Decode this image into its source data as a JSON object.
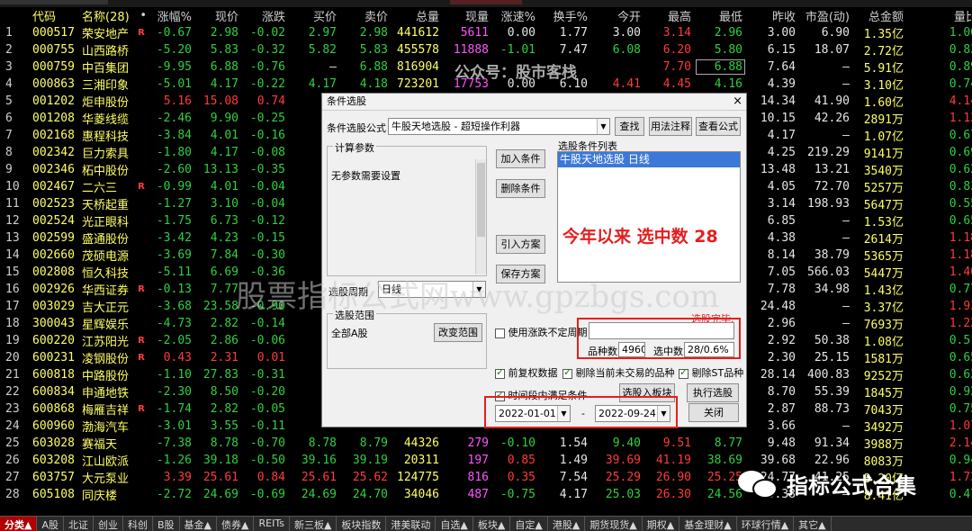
{
  "columns": [
    "",
    "代码",
    "名称(28)",
    "•",
    "涨幅%",
    "现价",
    "涨跌",
    "买价",
    "卖价",
    "总量",
    "现量",
    "涨速%",
    "换手%",
    "今开",
    "最高",
    "最低",
    "昨收",
    "市盈(动)",
    "总金额",
    "量比"
  ],
  "rows": [
    [
      "1",
      "000517",
      "荣安地产",
      "R",
      "-0.67",
      "2.98",
      "-0.02",
      "2.97",
      "2.98",
      "441612",
      "5611",
      "0.00",
      "1.77",
      "3.00",
      "3.14",
      "2.96",
      "3.00",
      "6.90",
      "1.35亿",
      "1.00"
    ],
    [
      "2",
      "000755",
      "山西路桥",
      "",
      "-5.20",
      "5.83",
      "-0.32",
      "5.82",
      "5.83",
      "455578",
      "11888",
      "-1.01",
      "7.47",
      "6.08",
      "6.20",
      "5.80",
      "6.15",
      "18.07",
      "2.72亿",
      "0.83"
    ],
    [
      "3",
      "000759",
      "中百集团",
      "",
      "-9.95",
      "6.88",
      "-0.76",
      "—",
      "6.88",
      "816904",
      "",
      "",
      "",
      "",
      "7.70",
      "6.88",
      "7.64",
      "—",
      "5.91亿",
      "0.89"
    ],
    [
      "4",
      "000863",
      "三湘印象",
      "",
      "-5.01",
      "4.17",
      "-0.22",
      "4.17",
      "4.18",
      "723201",
      "17753",
      "0.00",
      "6.10",
      "4.41",
      "4.45",
      "4.16",
      "4.39",
      "—",
      "3.10亿",
      "0.74"
    ],
    [
      "5",
      "001202",
      "炬申股份",
      "",
      "5.16",
      "15.08",
      "0.74",
      "",
      "",
      "",
      "",
      "",
      "",
      "",
      "",
      "",
      "14.34",
      "41.90",
      "1.60亿",
      "4.14"
    ],
    [
      "6",
      "001208",
      "华菱线缆",
      "",
      "-2.46",
      "9.90",
      "-0.25",
      "",
      "",
      "",
      "",
      "",
      "",
      "",
      "",
      "",
      "10.15",
      "42.26",
      "2891万",
      "1.12"
    ],
    [
      "7",
      "002168",
      "惠程科技",
      "",
      "-3.84",
      "4.01",
      "-0.16",
      "",
      "",
      "",
      "",
      "",
      "",
      "",
      "",
      "",
      "4.17",
      "—",
      "1.07亿",
      "0.67"
    ],
    [
      "8",
      "002342",
      "巨力索具",
      "",
      "-1.80",
      "4.17",
      "-0.08",
      "",
      "",
      "",
      "",
      "",
      "",
      "",
      "",
      "",
      "4.25",
      "219.29",
      "9141万",
      "0.69"
    ],
    [
      "9",
      "002346",
      "柘中股份",
      "",
      "-2.60",
      "13.13",
      "-0.35",
      "",
      "",
      "",
      "",
      "",
      "",
      "",
      "",
      "",
      "13.48",
      "13.21",
      "3540万",
      "0.62"
    ],
    [
      "10",
      "002467",
      "二六三",
      "R",
      "-0.99",
      "4.01",
      "-0.04",
      "",
      "",
      "",
      "",
      "",
      "",
      "",
      "",
      "",
      "4.05",
      "72.70",
      "5257万",
      "0.83"
    ],
    [
      "11",
      "002523",
      "天桥起重",
      "",
      "-1.27",
      "3.10",
      "-0.04",
      "",
      "",
      "",
      "",
      "",
      "",
      "",
      "",
      "",
      "3.14",
      "198.93",
      "5647万",
      "0.55"
    ],
    [
      "12",
      "002524",
      "光正眼科",
      "",
      "-1.75",
      "6.73",
      "-0.12",
      "",
      "",
      "",
      "",
      "",
      "",
      "",
      "",
      "",
      "6.85",
      "—",
      "1.53亿",
      "0.65"
    ],
    [
      "13",
      "002599",
      "盛通股份",
      "",
      "-3.42",
      "4.23",
      "-0.15",
      "",
      "",
      "",
      "",
      "",
      "",
      "",
      "",
      "",
      "4.38",
      "—",
      "2614万",
      "1.18"
    ],
    [
      "14",
      "002660",
      "茂硕电源",
      "",
      "-3.69",
      "7.84",
      "-0.30",
      "",
      "",
      "",
      "",
      "",
      "",
      "",
      "",
      "",
      "8.14",
      "38.79",
      "5365万",
      "1.18"
    ],
    [
      "15",
      "002808",
      "恒久科技",
      "",
      "-5.11",
      "6.69",
      "-0.36",
      "",
      "",
      "",
      "",
      "",
      "",
      "",
      "",
      "",
      "7.05",
      "566.03",
      "5447万",
      "1.40"
    ],
    [
      "16",
      "002926",
      "华西证券",
      "R",
      "-0.13",
      "7.77",
      "",
      "",
      "",
      "",
      "",
      "",
      "",
      "",
      "",
      "",
      "7.78",
      "34.98",
      "1.43亿",
      "0.77"
    ],
    [
      "17",
      "003029",
      "吉大正元",
      "",
      "-3.68",
      "23.58",
      "-0.90",
      "",
      "",
      "",
      "",
      "",
      "",
      "",
      "",
      "",
      "24.48",
      "—",
      "3.37亿",
      "1.93"
    ],
    [
      "18",
      "300043",
      "星辉娱乐",
      "",
      "-4.73",
      "2.82",
      "-0.14",
      "",
      "",
      "",
      "",
      "",
      "",
      "",
      "",
      "",
      "2.96",
      "—",
      "7693万",
      "1.22"
    ],
    [
      "19",
      "600220",
      "江苏阳光",
      "R",
      "-2.05",
      "2.86",
      "-0.06",
      "",
      "",
      "",
      "",
      "",
      "",
      "",
      "",
      "",
      "2.92",
      "50.38",
      "1.08亿",
      "0.51"
    ],
    [
      "20",
      "600231",
      "凌钢股份",
      "R",
      "0.43",
      "2.31",
      "0.01",
      "",
      "",
      "",
      "",
      "",
      "",
      "",
      "",
      "",
      "2.30",
      "25.15",
      "1581万",
      "0.65"
    ],
    [
      "21",
      "600818",
      "中路股份",
      "",
      "-1.10",
      "27.83",
      "-0.31",
      "",
      "",
      "",
      "",
      "",
      "",
      "",
      "",
      "",
      "28.14",
      "400.83",
      "9252万",
      "0.62"
    ],
    [
      "22",
      "600834",
      "申通地铁",
      "",
      "-2.30",
      "8.50",
      "-0.20",
      "",
      "",
      "",
      "",
      "",
      "",
      "",
      "",
      "",
      "8.70",
      "55.39",
      "1845万",
      "0.92"
    ],
    [
      "23",
      "600868",
      "梅雁吉祥",
      "R",
      "-1.74",
      "2.82",
      "-0.05",
      "",
      "",
      "",
      "",
      "",
      "",
      "",
      "",
      "",
      "2.87",
      "88.73",
      "7043万",
      "0.75"
    ],
    [
      "24",
      "600960",
      "渤海汽车",
      "",
      "-3.01",
      "3.55",
      "-0.11",
      "",
      "",
      "",
      "",
      "",
      "",
      "",
      "",
      "",
      "3.66",
      "—",
      "3492万",
      "1.07"
    ],
    [
      "25",
      "603028",
      "赛福天",
      "",
      "-7.38",
      "8.78",
      "-0.70",
      "8.78",
      "8.79",
      "44326",
      "279",
      "-0.10",
      "1.54",
      "9.40",
      "9.51",
      "8.77",
      "9.48",
      "91.34",
      "3988万",
      "2.14"
    ],
    [
      "26",
      "603208",
      "江山欧派",
      "",
      "-1.26",
      "39.18",
      "-0.50",
      "39.16",
      "39.19",
      "20311",
      "197",
      "0.85",
      "1.49",
      "39.69",
      "41.19",
      "38.69",
      "39.68",
      "22.96",
      "8083万",
      "0.94"
    ],
    [
      "27",
      "603757",
      "大元泵业",
      "",
      "3.39",
      "25.61",
      "0.84",
      "25.61",
      "25.62",
      "124775",
      "816",
      "0.35",
      "7.54",
      "25.29",
      "26.90",
      "25.25",
      "24.77",
      "41.25",
      "3.20亿",
      "1.72"
    ],
    [
      "28",
      "605108",
      "同庆楼",
      "",
      "-2.72",
      "24.69",
      "-0.69",
      "24.69",
      "24.70",
      "34046",
      "487",
      "-0.75",
      "4.17",
      "25.03",
      "26.30",
      "24.56",
      "25.38",
      "—",
      "8.41亿",
      "0.47"
    ]
  ],
  "tabs": [
    "分类▲",
    "A股",
    "北证",
    "创业",
    "科创",
    "B股",
    "基金▲",
    "债券▲",
    "REITs",
    "新三板▲",
    "板块指数",
    "港美联动",
    "自选▲",
    "板块▲",
    "自定▲",
    "港股▲",
    "期货现货▲",
    "期权▲",
    "基金理财▲",
    "环球行情▲",
    "其它▲"
  ],
  "watermarks": {
    "top": "公众号：股市客栈",
    "middle": "股票指标公式网www.gpzbgs.com",
    "wechat": "指标公式合集"
  },
  "dialog": {
    "title": "条件选股",
    "close": "×",
    "formula_label": "条件选股公式",
    "formula_value": "牛股天地选股 - 超短操作利器",
    "btn_find": "查找",
    "btn_usage": "用法注释",
    "btn_view": "查看公式",
    "params_title": "计算参数",
    "params_text": "无参数需要设置",
    "btn_add": "加入条件",
    "btn_delete": "删除条件",
    "list_title": "选股条件列表",
    "list_item": "牛股天地选股  日线",
    "annotation": "今年以来 选中数 28",
    "btn_import": "引入方案",
    "btn_save": "保存方案",
    "period_label": "选股周期",
    "period_value": "日线",
    "range_title": "选股范围",
    "range_value": "全部A股",
    "btn_change_range": "改变范围",
    "status": "选股完毕.",
    "chk_uncertain": "使用涨跌不定周期",
    "total_label": "品种数",
    "total_value": "4960",
    "selected_label": "选中数",
    "selected_value": "28/0.6%",
    "chk_prerights": "前复权数据",
    "chk_untraded": "剔除当前未交易的品种",
    "chk_st": "剔除ST品种",
    "chk_timerange": "时间段内满足条件",
    "btn_to_block": "选股入板块",
    "btn_execute": "执行选股",
    "date_from": "2022-01-01",
    "date_sep": "-",
    "date_to": "2022-09-24",
    "btn_close": "关闭"
  }
}
